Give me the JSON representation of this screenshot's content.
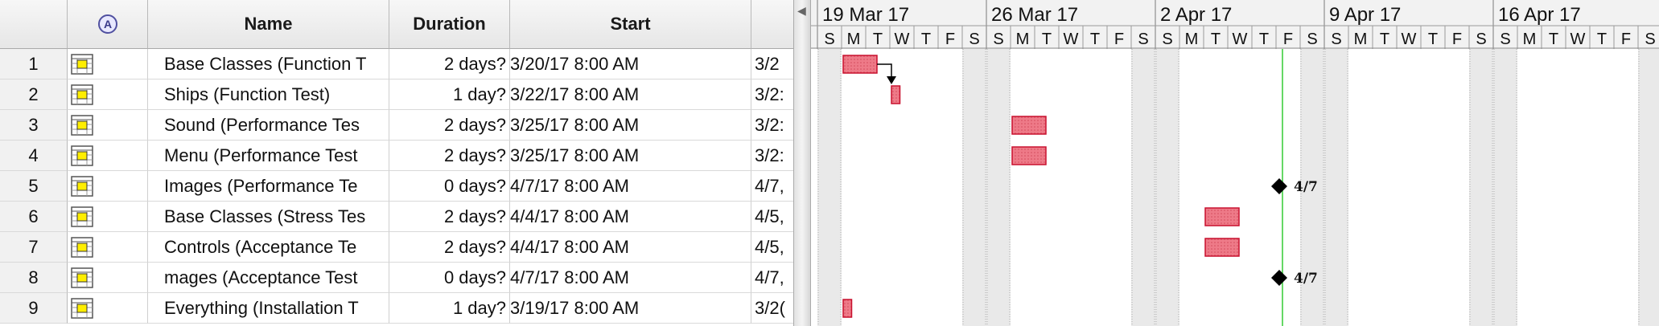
{
  "table": {
    "columns": [
      {
        "key": "id",
        "label": ""
      },
      {
        "key": "indicator",
        "label": "",
        "icon": "constraint-info-icon"
      },
      {
        "key": "name",
        "label": "Name"
      },
      {
        "key": "duration",
        "label": "Duration"
      },
      {
        "key": "start",
        "label": "Start"
      },
      {
        "key": "finish",
        "label": ""
      }
    ],
    "rows": [
      {
        "id": "1",
        "name": "Base Classes (Function T",
        "duration": "2 days?",
        "start": "3/20/17 8:00 AM",
        "finish": "3/2"
      },
      {
        "id": "2",
        "name": "Ships (Function Test)",
        "duration": "1 day?",
        "start": "3/22/17 8:00 AM",
        "finish": "3/2:"
      },
      {
        "id": "3",
        "name": "Sound (Performance Tes",
        "duration": "2 days?",
        "start": "3/25/17 8:00 AM",
        "finish": "3/2:"
      },
      {
        "id": "4",
        "name": "Menu (Performance Test",
        "duration": "2 days?",
        "start": "3/25/17 8:00 AM",
        "finish": "3/2:"
      },
      {
        "id": "5",
        "name": "Images (Performance Te",
        "duration": "0 days?",
        "start": "4/7/17 8:00 AM",
        "finish": "4/7,"
      },
      {
        "id": "6",
        "name": "Base Classes (Stress Tes",
        "duration": "2 days?",
        "start": "4/4/17 8:00 AM",
        "finish": "4/5,"
      },
      {
        "id": "7",
        "name": "Controls (Acceptance Te",
        "duration": "2 days?",
        "start": "4/4/17 8:00 AM",
        "finish": "4/5,"
      },
      {
        "id": "8",
        "name": "mages (Acceptance Test",
        "duration": "0 days?",
        "start": "4/7/17 8:00 AM",
        "finish": "4/7,"
      },
      {
        "id": "9",
        "name": "Everything (Installation T",
        "duration": "1 day?",
        "start": "3/19/17 8:00 AM",
        "finish": "3/2("
      }
    ]
  },
  "gantt": {
    "weeks": [
      "19 Mar 17",
      "26 Mar 17",
      "2 Apr 17",
      "9 Apr 17",
      "16 Apr 17"
    ],
    "day_letters": [
      "S",
      "M",
      "T",
      "W",
      "T",
      "F",
      "S"
    ],
    "first_day": "2017-03-19",
    "today": "2017-04-07",
    "colors": {
      "bar_fill": "#ee7a88",
      "bar_stroke": "#c8102e",
      "milestone": "#000000",
      "today_line": "#33cc33",
      "weekend": "#e9e9e9",
      "grid": "#b0b0b0"
    },
    "items": [
      {
        "row": 0,
        "type": "task",
        "start": "2017-03-20",
        "days": 2
      },
      {
        "row": 1,
        "type": "task",
        "start": "2017-03-22",
        "days": 0.5
      },
      {
        "row": 2,
        "type": "task",
        "start": "2017-03-27",
        "days": 2
      },
      {
        "row": 3,
        "type": "task",
        "start": "2017-03-27",
        "days": 2
      },
      {
        "row": 4,
        "type": "milestone",
        "start": "2017-04-07",
        "label": "4/7"
      },
      {
        "row": 5,
        "type": "task",
        "start": "2017-04-04",
        "days": 2
      },
      {
        "row": 6,
        "type": "task",
        "start": "2017-04-04",
        "days": 2
      },
      {
        "row": 7,
        "type": "milestone",
        "start": "2017-04-07",
        "label": "4/7"
      },
      {
        "row": 8,
        "type": "task",
        "start": "2017-03-20",
        "days": 0.5
      }
    ],
    "dependencies": [
      {
        "from": 0,
        "to": 1
      }
    ]
  }
}
